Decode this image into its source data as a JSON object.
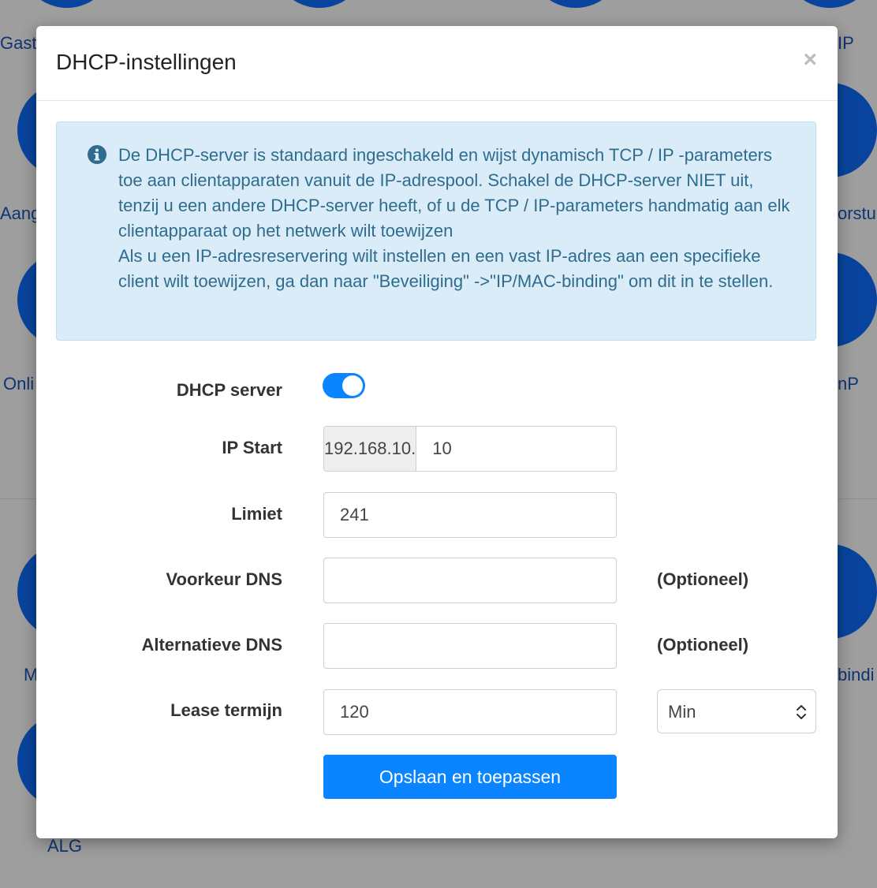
{
  "background": {
    "labels": [
      "Gast",
      "IP",
      "Aang",
      "orstu",
      "Onli",
      "nP",
      "M",
      "bindi",
      "ALG"
    ]
  },
  "modal": {
    "title": "DHCP-instellingen",
    "close_icon": "close-icon",
    "info": {
      "icon": "info-icon",
      "paragraph1": "De DHCP-server is standaard ingeschakeld en wijst dynamisch TCP / IP -parameters toe aan clientapparaten vanuit de IP-adrespool. Schakel de DHCP-server NIET uit, tenzij u een andere DHCP-server heeft, of u de TCP / IP-parameters handmatig aan elk clientapparaat op het netwerk wilt toewijzen",
      "paragraph2": "Als u een IP-adresreservering wilt instellen en een vast IP-adres aan een specifieke client wilt toewijzen, ga dan naar \"Beveiliging\" ->\"IP/MAC-binding\" om dit in te stellen."
    },
    "form": {
      "dhcp_server": {
        "label": "DHCP server",
        "enabled": true
      },
      "ip_start": {
        "label": "IP Start",
        "prefix": "192.168.10.",
        "value": "10"
      },
      "limit": {
        "label": "Limiet",
        "value": "241"
      },
      "preferred_dns": {
        "label": "Voorkeur DNS",
        "value": "",
        "note": "(Optioneel)"
      },
      "alternate_dns": {
        "label": "Alternatieve DNS",
        "value": "",
        "note": "(Optioneel)"
      },
      "lease": {
        "label": "Lease termijn",
        "value": "120",
        "unit": "Min"
      },
      "save_label": "Opslaan en toepassen"
    }
  },
  "colors": {
    "accent": "#0a84ff",
    "info_bg": "#d9ecf7",
    "info_text": "#2f6c8f"
  }
}
